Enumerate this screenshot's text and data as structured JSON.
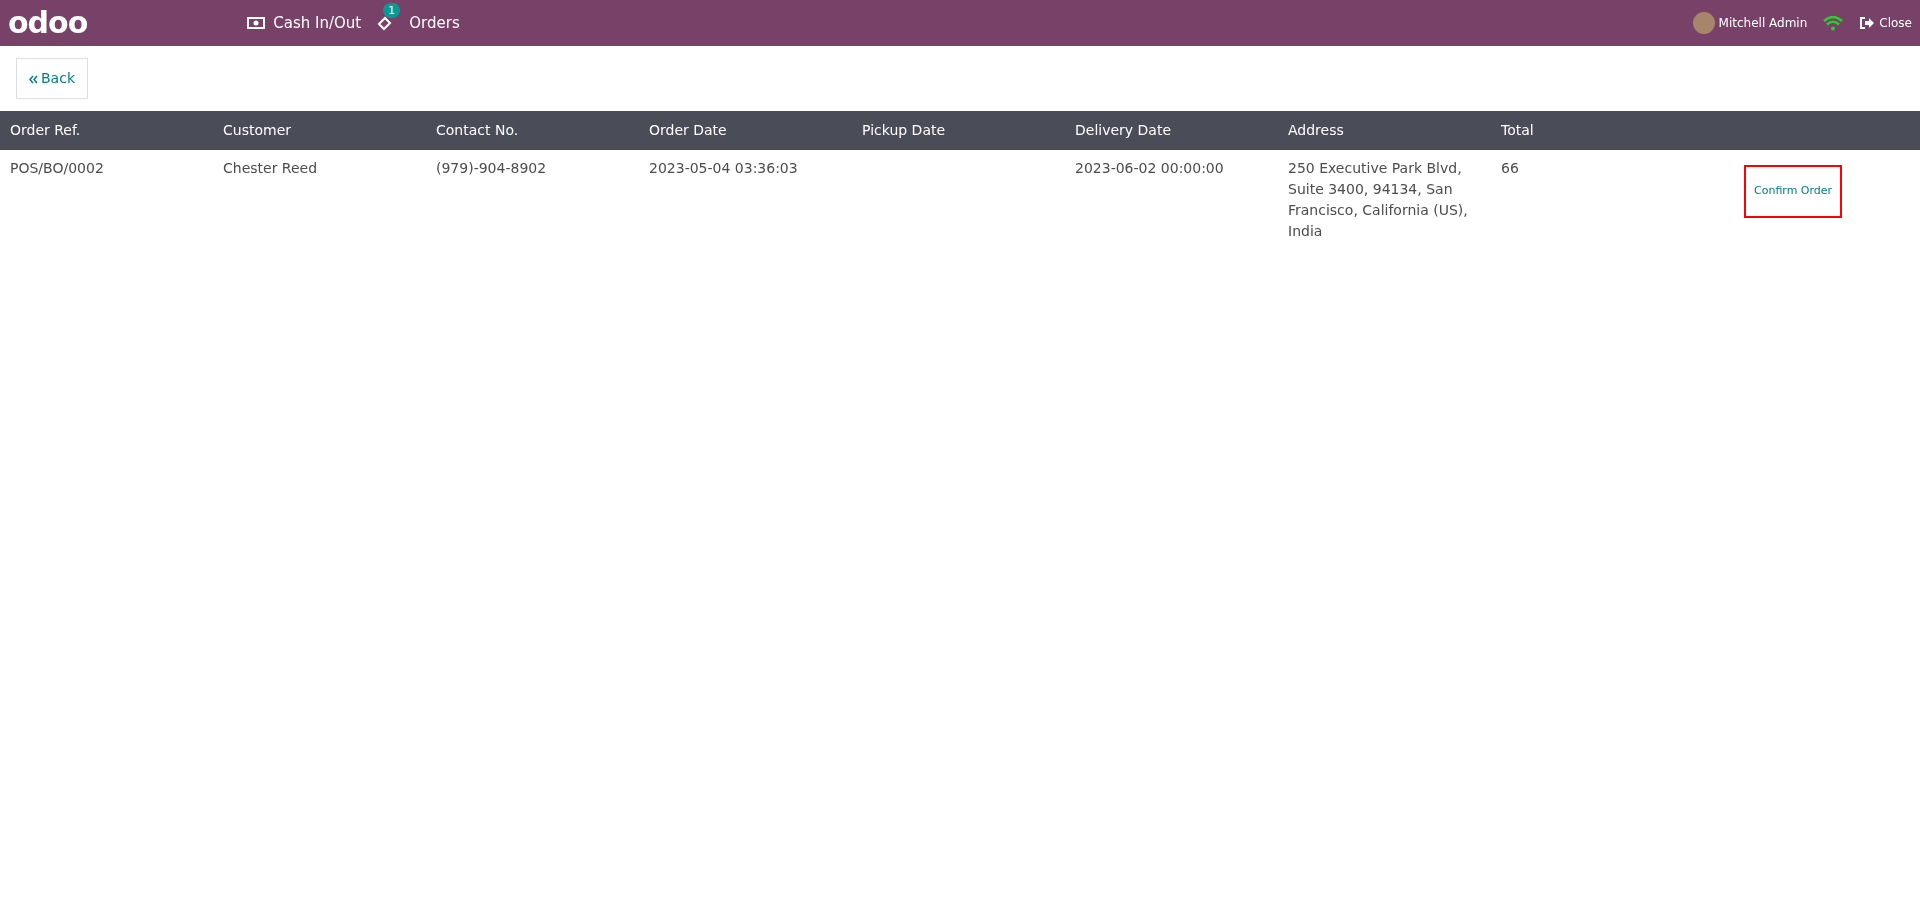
{
  "header": {
    "logo": "odoo",
    "nav": [
      {
        "kind": "cash",
        "label": "Cash In/Out"
      },
      {
        "kind": "orders",
        "label": "Orders",
        "badge": "1"
      }
    ],
    "user": "Mitchell Admin",
    "close": "Close"
  },
  "back_button": "Back",
  "table": {
    "columns": [
      "Order Ref.",
      "Customer",
      "Contact No.",
      "Order Date",
      "Pickup Date",
      "Delivery Date",
      "Address",
      "Total"
    ],
    "rows": [
      {
        "cells": [
          "POS/BO/0002",
          "Chester Reed",
          "(979)-904-8902",
          "2023-05-04 03:36:03",
          "",
          "2023-06-02 00:00:00",
          "250 Executive Park Blvd, Suite 3400, 94134, San Francisco, California (US), India",
          "66"
        ],
        "action": "Confirm Order"
      }
    ]
  }
}
